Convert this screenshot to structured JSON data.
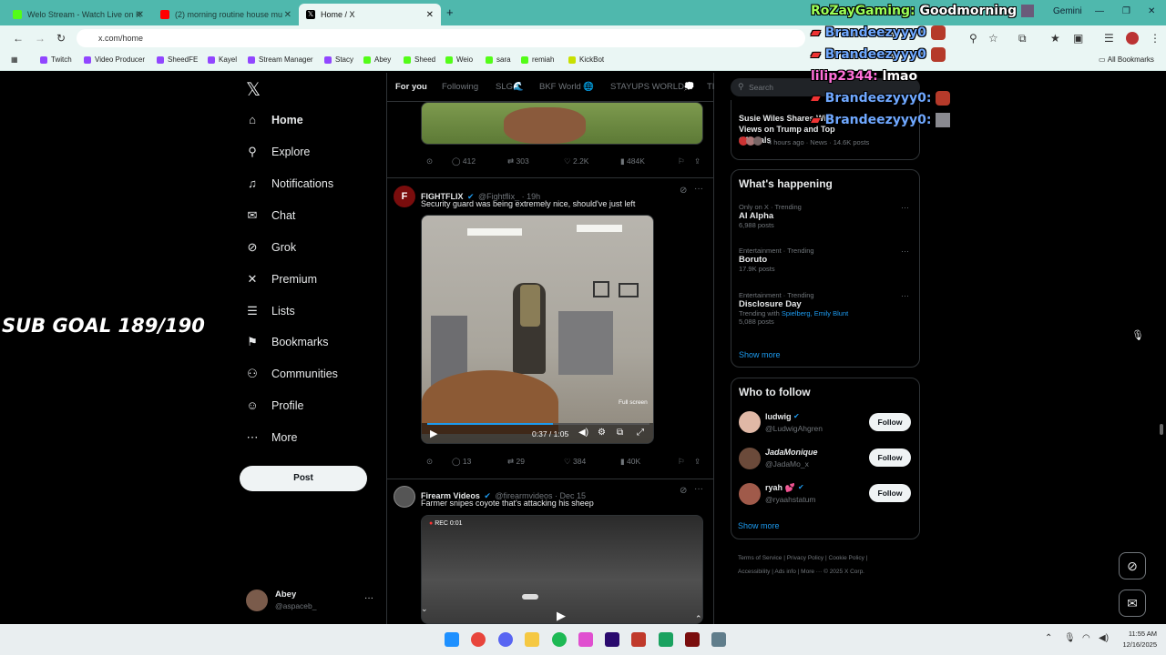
{
  "browser": {
    "tabs": [
      {
        "title": "Welo Stream - Watch Live on K",
        "color": "#53fc18"
      },
      {
        "title": "(2) morning routine house mu",
        "color": "#ff0000"
      },
      {
        "title": "Home / X",
        "color": "#000000"
      }
    ],
    "url": "x.com/home",
    "bookmarks": [
      {
        "label": "Twitch",
        "color": "#9146ff"
      },
      {
        "label": "Video Producer",
        "color": "#9146ff"
      },
      {
        "label": "SheedFE",
        "color": "#9146ff"
      },
      {
        "label": "Kayel",
        "color": "#9146ff"
      },
      {
        "label": "Stream Manager",
        "color": "#9146ff"
      },
      {
        "label": "Stacy",
        "color": "#9146ff"
      },
      {
        "label": "Abey",
        "color": "#53fc18"
      },
      {
        "label": "Sheed",
        "color": "#53fc18"
      },
      {
        "label": "Weio",
        "color": "#53fc18"
      },
      {
        "label": "sara",
        "color": "#53fc18"
      },
      {
        "label": "remiah",
        "color": "#53fc18"
      },
      {
        "label": "KickBot",
        "color": "#c8e000"
      }
    ],
    "all_bookmarks": "All Bookmarks",
    "gemini": "Gemini"
  },
  "sidebar": {
    "items": [
      {
        "label": "Home",
        "icon": "home-icon",
        "glyph": "⌂"
      },
      {
        "label": "Explore",
        "icon": "search-icon",
        "glyph": "⚲"
      },
      {
        "label": "Notifications",
        "icon": "bell-icon",
        "glyph": "🔔"
      },
      {
        "label": "Chat",
        "icon": "mail-icon",
        "glyph": "✉"
      },
      {
        "label": "Grok",
        "icon": "grok-icon",
        "glyph": "⊘"
      },
      {
        "label": "Premium",
        "icon": "x-icon",
        "glyph": "✕"
      },
      {
        "label": "Lists",
        "icon": "list-icon",
        "glyph": "☰"
      },
      {
        "label": "Bookmarks",
        "icon": "bookmark-icon",
        "glyph": "⚑"
      },
      {
        "label": "Communities",
        "icon": "people-icon",
        "glyph": "👥"
      },
      {
        "label": "Profile",
        "icon": "person-icon",
        "glyph": "👤"
      },
      {
        "label": "More",
        "icon": "more-icon",
        "glyph": "⋯"
      }
    ],
    "post_label": "Post",
    "user": {
      "name": "Abey",
      "handle": "@aspaceb_"
    }
  },
  "feed": {
    "tabs": [
      "For you",
      "Following",
      "SLG🌊",
      "BKF World 🌐",
      "STAYUPS WORLD💭",
      "TI"
    ],
    "top_actions": {
      "replies": "412",
      "reposts": "303",
      "likes": "2.2K",
      "views": "484K"
    },
    "tweet1": {
      "name": "FIGHTFLIX",
      "meta": "@Fightflix_ · 19h",
      "text": "Security guard was being extremely nice, should've just left",
      "video_time": "0:37 / 1:05",
      "fullscreen_tip": "Full screen",
      "actions": {
        "replies": "13",
        "reposts": "29",
        "likes": "384",
        "views": "40K"
      }
    },
    "tweet2": {
      "name": "Firearm Videos",
      "meta": "@firearmvideos · Dec 15",
      "text": "Farmer snipes coyote that's attacking his sheep",
      "rec": "REC 0:01"
    }
  },
  "right": {
    "search_placeholder": "Search",
    "news": {
      "title": "Susie Wiles Shares Wild Views on Trump and Top Officials",
      "meta": "4 hours ago · News · 14.6K posts"
    },
    "happening_title": "What's happening",
    "trends": [
      {
        "context": "Only on X · Trending",
        "name": "AI Alpha",
        "posts": "6,988 posts",
        "with": ""
      },
      {
        "context": "Entertainment · Trending",
        "name": "Boruto",
        "posts": "17.9K posts",
        "with": ""
      },
      {
        "context": "Entertainment · Trending",
        "name": "Disclosure Day",
        "posts": "5,088 posts",
        "with_prefix": "Trending with",
        "with": "Spielberg, Emily Blunt"
      }
    ],
    "show_more": "Show more",
    "follow_title": "Who to follow",
    "follow": [
      {
        "name": "ludwig",
        "handle": "@LudwigAhgren",
        "btn": "Follow"
      },
      {
        "name": "JadaMonique",
        "handle": "@JadaMo_x",
        "btn": "Follow"
      },
      {
        "name": "ryah 💕",
        "handle": "@ryaahstatum",
        "btn": "Follow"
      }
    ],
    "show_more2": "Show more",
    "footer": [
      "Terms of Service",
      "Privacy Policy",
      "Cookie Policy",
      "Accessibility",
      "Ads info",
      "More ···",
      "© 2025 X Corp."
    ]
  },
  "overlay": {
    "chat": [
      {
        "user": "RoZayGaming:",
        "msg": "Goodmorning",
        "color": "#9cff57"
      },
      {
        "user": "Brandeezyyy0",
        "msg": "",
        "color": "#6fa8ff"
      },
      {
        "user": "Brandeezyyy0",
        "msg": "",
        "color": "#6fa8ff"
      },
      {
        "user": "lilip2344:",
        "msg": "lmao",
        "color": "#ff6fd8"
      },
      {
        "user": "Brandeezyyy0:",
        "msg": "",
        "color": "#6fa8ff"
      },
      {
        "user": "Brandeezyyy0:",
        "msg": "",
        "color": "#6fa8ff"
      }
    ],
    "sub_goal": "SUB GOAL 189/190"
  },
  "taskbar": {
    "time": "11:55 AM",
    "date": "12/16/2025"
  }
}
